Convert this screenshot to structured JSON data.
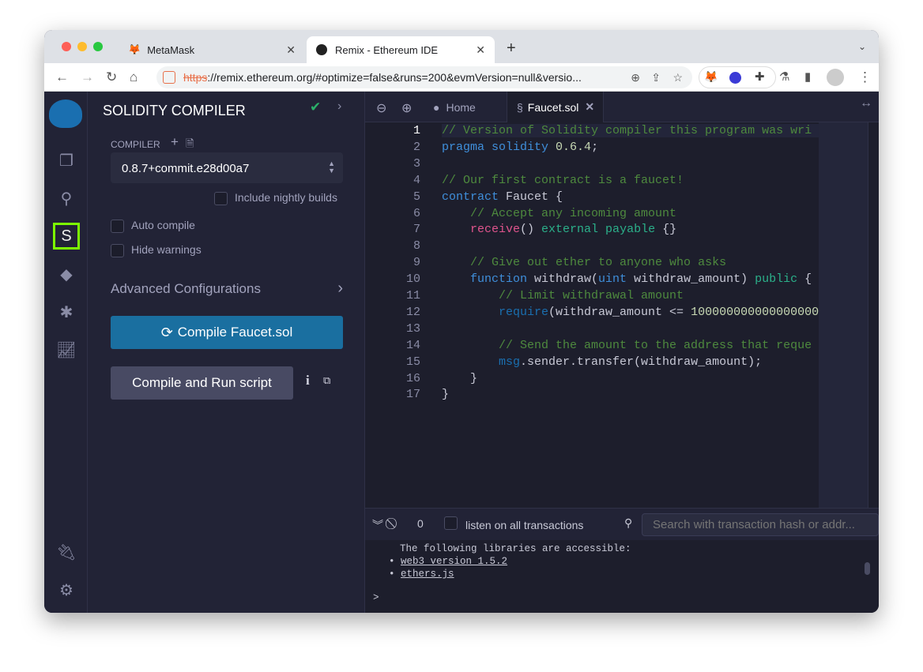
{
  "browser": {
    "tabs": [
      {
        "label": "MetaMask"
      },
      {
        "label": "Remix - Ethereum IDE"
      }
    ],
    "url_scheme": "https",
    "url_rest": "://remix.ethereum.org/#optimize=false&runs=200&evmVersion=null&versio..."
  },
  "side": {
    "title": "SOLIDITY COMPILER",
    "compiler_label": "COMPILER",
    "compiler_version": "0.8.7+commit.e28d00a7",
    "nightly": "Include nightly builds",
    "auto_compile": "Auto compile",
    "hide_warnings": "Hide warnings",
    "advanced": "Advanced Configurations",
    "compile_btn": "Compile Faucet.sol",
    "run_btn": "Compile and Run script"
  },
  "editor": {
    "tabs": [
      {
        "label": "Home"
      },
      {
        "label": "Faucet.sol"
      }
    ],
    "lines": [
      [
        [
          "c",
          "// Version of Solidity compiler this program was wri"
        ]
      ],
      [
        [
          "k",
          "pragma solidity"
        ],
        [
          "",
          " "
        ],
        [
          "n",
          "0.6.4"
        ],
        [
          "",
          ";"
        ]
      ],
      [],
      [
        [
          "c",
          "// Our first contract is a faucet!"
        ]
      ],
      [
        [
          "k",
          "contract"
        ],
        [
          "",
          " Faucet {"
        ]
      ],
      [
        [
          "",
          "    "
        ],
        [
          "c",
          "// Accept any incoming amount"
        ]
      ],
      [
        [
          "",
          "    "
        ],
        [
          "p",
          "receive"
        ],
        [
          "",
          "() "
        ],
        [
          "g",
          "external payable"
        ],
        [
          "",
          " {}"
        ]
      ],
      [],
      [
        [
          "",
          "    "
        ],
        [
          "c",
          "// Give out ether to anyone who asks"
        ]
      ],
      [
        [
          "",
          "    "
        ],
        [
          "k",
          "function"
        ],
        [
          "",
          " withdraw("
        ],
        [
          "k",
          "uint"
        ],
        [
          "",
          " withdraw_amount) "
        ],
        [
          "g",
          "public"
        ],
        [
          "",
          " {"
        ]
      ],
      [
        [
          "",
          "        "
        ],
        [
          "c",
          "// Limit withdrawal amount"
        ]
      ],
      [
        [
          "",
          "        "
        ],
        [
          "b",
          "require"
        ],
        [
          "",
          "(withdraw_amount <= "
        ],
        [
          "n",
          "100000000000000000"
        ]
      ],
      [],
      [
        [
          "",
          "        "
        ],
        [
          "c",
          "// Send the amount to the address that reque"
        ]
      ],
      [
        [
          "",
          "        "
        ],
        [
          "b",
          "msg"
        ],
        [
          "",
          ".sender.transfer(withdraw_amount);"
        ]
      ],
      [
        [
          "",
          "    }"
        ]
      ],
      [
        [
          "",
          "}"
        ]
      ]
    ]
  },
  "terminal": {
    "count": "0",
    "listen": "listen on all transactions",
    "search_placeholder": "Search with transaction hash or addr...",
    "intro": "The following libraries are accessible:",
    "libs": [
      "web3 version 1.5.2",
      "ethers.js"
    ],
    "prompt": ">"
  }
}
